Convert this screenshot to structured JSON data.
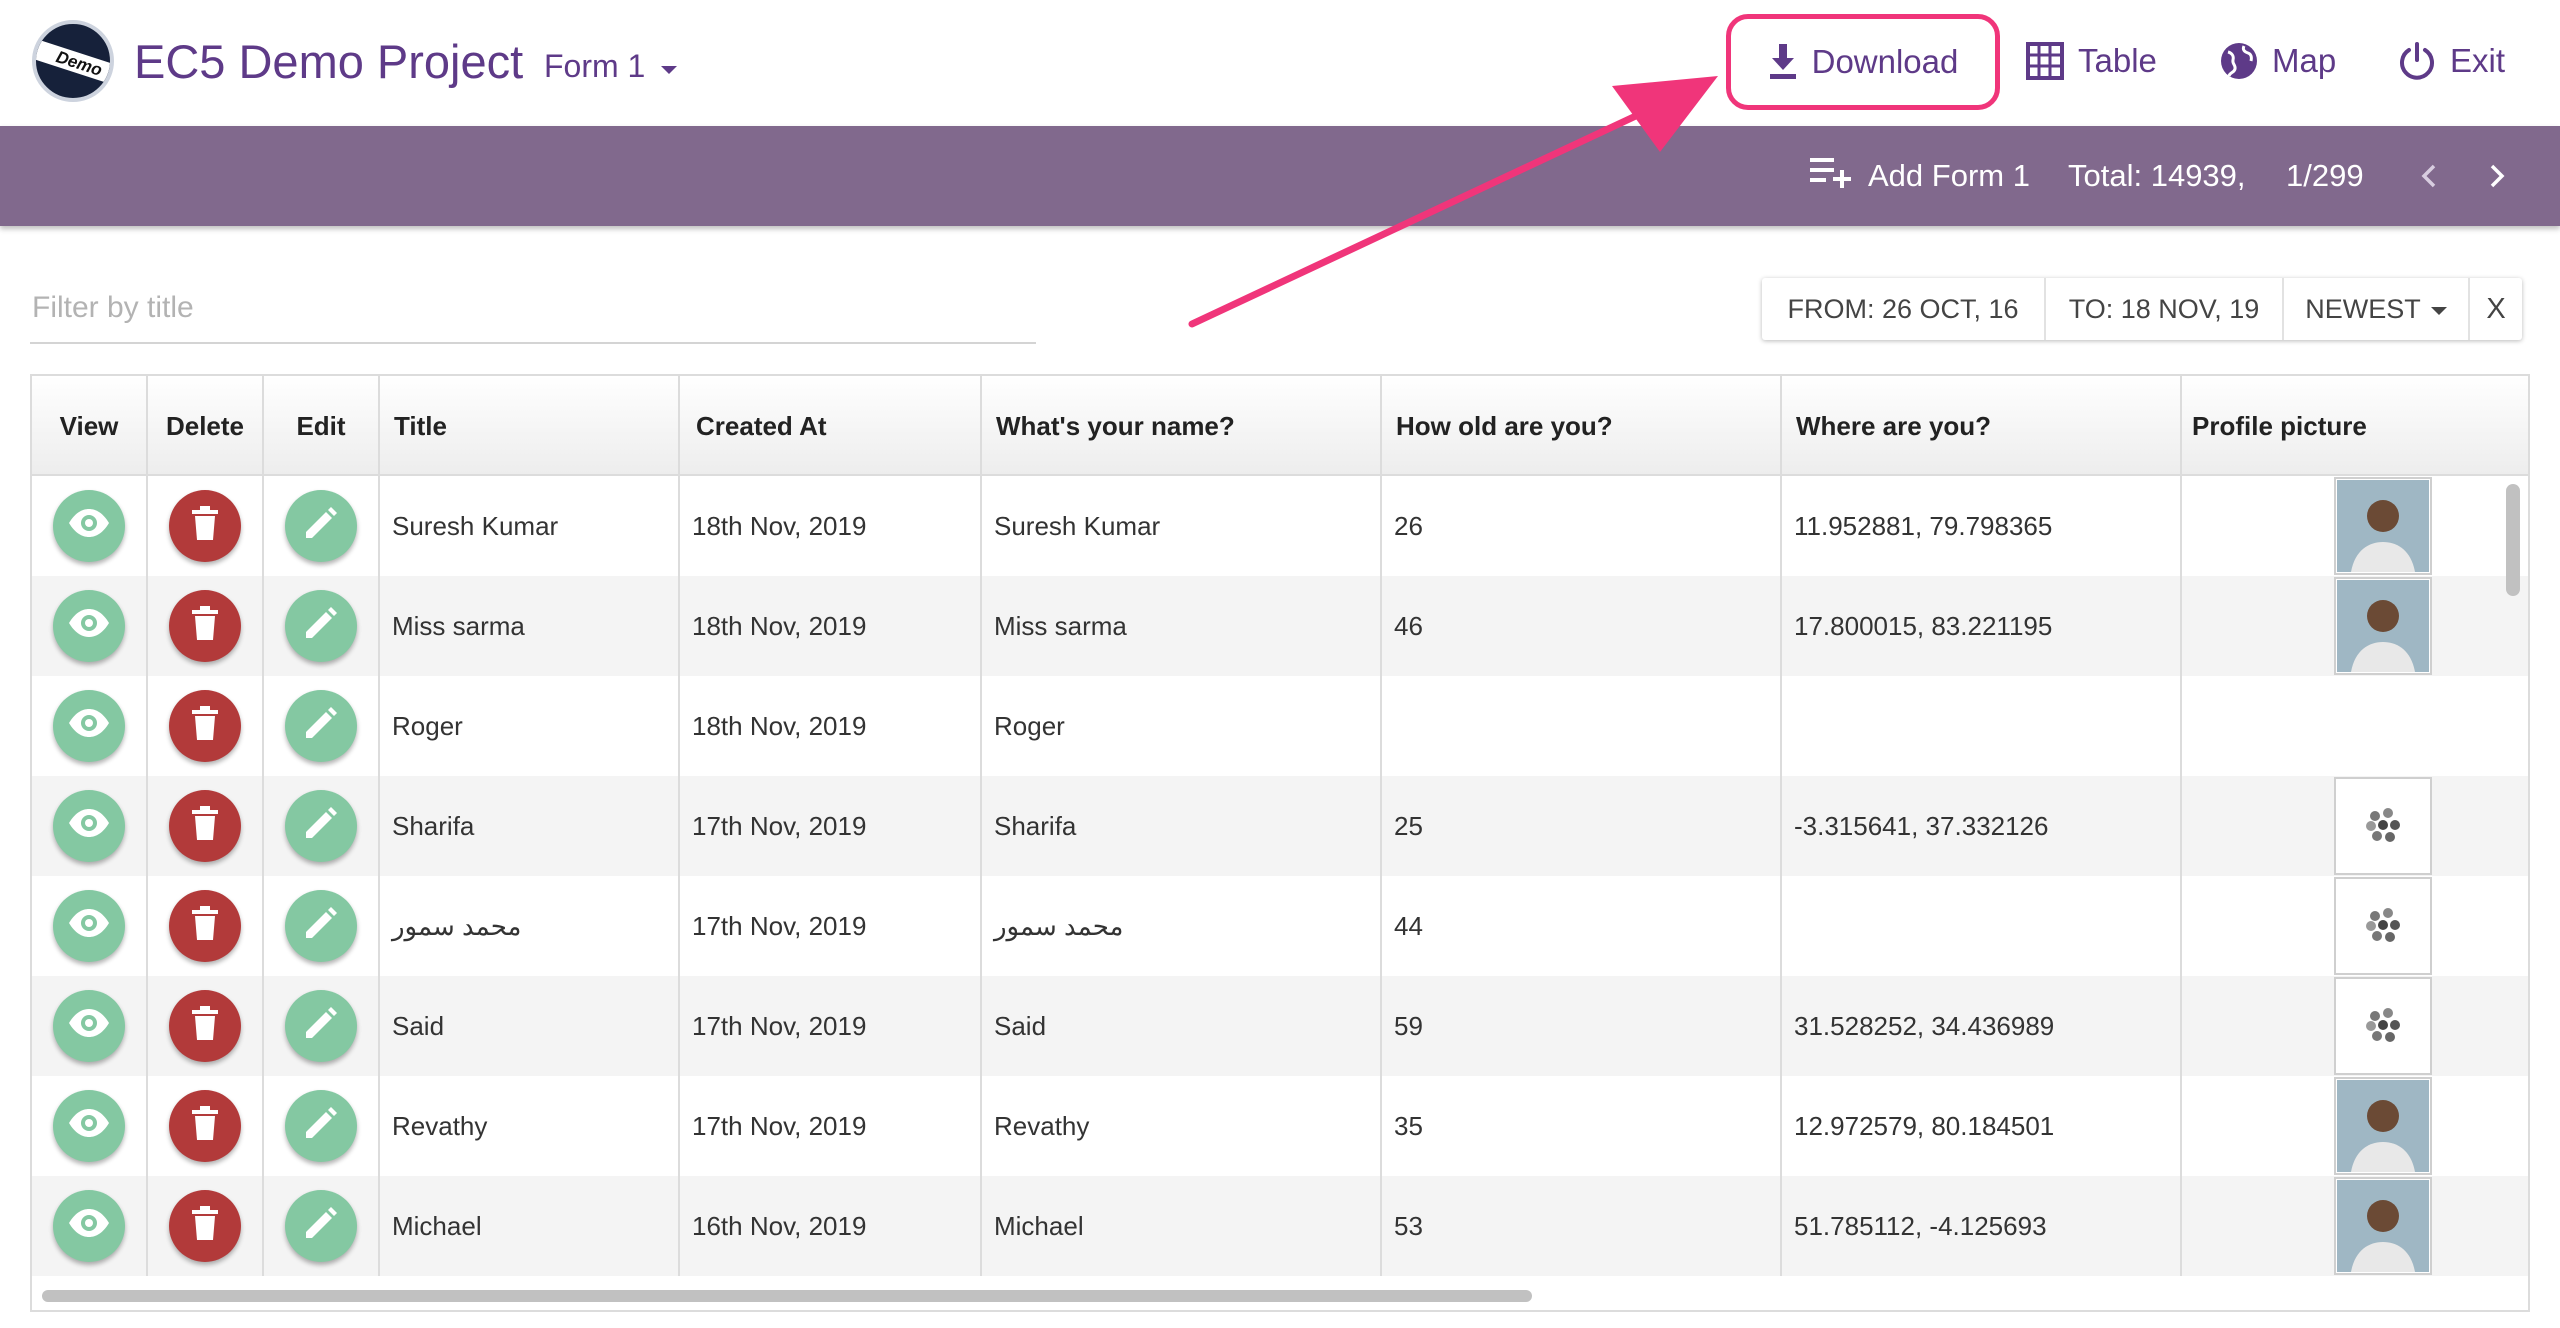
{
  "header": {
    "logo_text": "Demo",
    "project_title": "EC5 Demo Project",
    "form_selector": "Form 1",
    "nav": {
      "download": "Download",
      "table": "Table",
      "map": "Map",
      "exit": "Exit"
    },
    "highlight_color": "#f0357a",
    "brand_color": "#5e3a88"
  },
  "toolbar": {
    "add_form": "Add Form 1",
    "total": "Total: 14939,",
    "page": "1/299",
    "background_color": "#81698d"
  },
  "filters": {
    "title_placeholder": "Filter by title",
    "from": "FROM: 26 OCT, 16",
    "to": "TO: 18 NOV, 19",
    "sort": "NEWEST",
    "clear": "X"
  },
  "table": {
    "columns": [
      "View",
      "Delete",
      "Edit",
      "Title",
      "Created At",
      "What's your name?",
      "How old are you?",
      "Where are you?",
      "Profile picture"
    ],
    "rows": [
      {
        "title": "Suresh Kumar",
        "created_at": "18th Nov, 2019",
        "name": "Suresh Kumar",
        "age": "26",
        "location": "11.952881, 79.798365",
        "picture": "photo"
      },
      {
        "title": "Miss sarma",
        "created_at": "18th Nov, 2019",
        "name": "Miss sarma",
        "age": "46",
        "location": "17.800015, 83.221195",
        "picture": "photo"
      },
      {
        "title": "Roger",
        "created_at": "18th Nov, 2019",
        "name": "Roger",
        "age": "",
        "location": "",
        "picture": "none"
      },
      {
        "title": "Sharifa",
        "created_at": "17th Nov, 2019",
        "name": "Sharifa",
        "age": "25",
        "location": "-3.315641, 37.332126",
        "picture": "loading"
      },
      {
        "title": "محمد سمور",
        "created_at": "17th Nov, 2019",
        "name": "محمد سمور",
        "age": "44",
        "location": "",
        "picture": "loading"
      },
      {
        "title": "Said",
        "created_at": "17th Nov, 2019",
        "name": "Said",
        "age": "59",
        "location": "31.528252, 34.436989",
        "picture": "loading"
      },
      {
        "title": "Revathy",
        "created_at": "17th Nov, 2019",
        "name": "Revathy",
        "age": "35",
        "location": "12.972579, 80.184501",
        "picture": "photo"
      },
      {
        "title": "Michael",
        "created_at": "16th Nov, 2019",
        "name": "Michael",
        "age": "53",
        "location": "51.785112, -4.125693",
        "picture": "photo"
      }
    ],
    "action_colors": {
      "view": "#84c8a2",
      "delete": "#b23a3a",
      "edit": "#84c8a2"
    }
  },
  "icons": {
    "download": "download-icon",
    "table": "table-grid-icon",
    "map": "globe-icon",
    "exit": "power-icon",
    "add": "playlist-add-icon",
    "view": "eye-icon",
    "delete": "trash-icon",
    "edit": "pencil-icon"
  }
}
